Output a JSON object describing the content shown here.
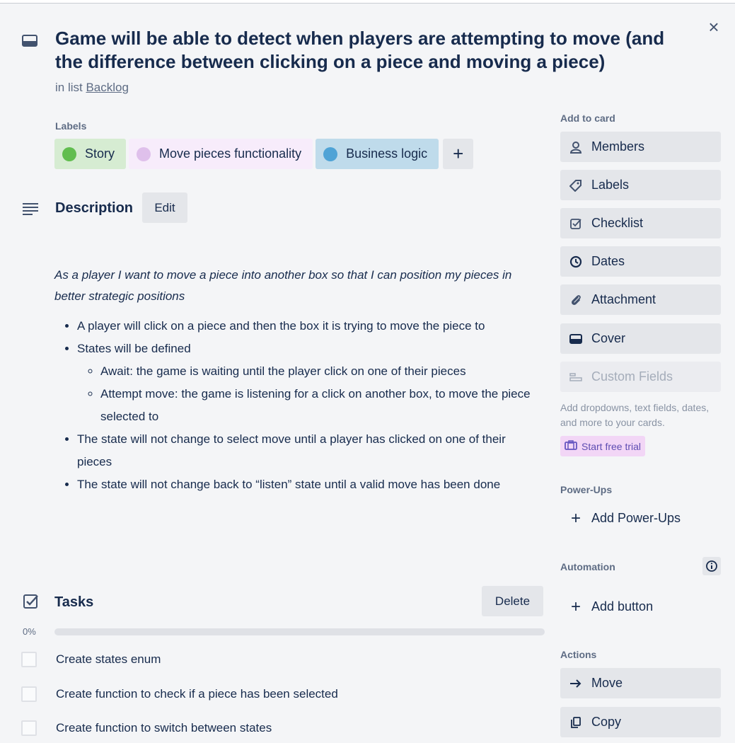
{
  "card": {
    "title": "Game will be able to detect when players are attempting to move (and the difference between clicking on a piece and moving a piece)",
    "in_list_prefix": "in list",
    "list_name": "Backlog",
    "close_label": "×"
  },
  "labels": {
    "heading": "Labels",
    "items": [
      {
        "name": "Story",
        "color": "#61bd4f",
        "bg": "#d6ecd2"
      },
      {
        "name": "Move pieces functionality",
        "color": "#dfc0eb",
        "bg": "#f7ecfb"
      },
      {
        "name": "Business logic",
        "color": "#4fa3d6",
        "bg": "#bfdbeb"
      }
    ],
    "add_label": "+"
  },
  "description": {
    "heading": "Description",
    "edit_label": "Edit",
    "story": "As a player I want to move a piece into another box so that I can position my pieces in better strategic positions",
    "bullets": [
      "A player will click on a piece and then the box it is trying to move the piece to",
      "States will be defined",
      "The state will not change to select move until a player has clicked on one of their pieces",
      "The state will not change back to “listen” state until a valid move has been done"
    ],
    "sub_bullets": [
      "Await: the game is waiting until the player click on one of their pieces",
      "Attempt move: the game is listening for a click on another box, to move the piece selected to"
    ]
  },
  "checklist": {
    "heading": "Tasks",
    "delete_label": "Delete",
    "progress_text": "0%",
    "progress_value": 0,
    "items": [
      {
        "text": "Create states enum",
        "checked": false
      },
      {
        "text": "Create function to check if a piece has been selected",
        "checked": false
      },
      {
        "text": "Create function to switch between states",
        "checked": false
      }
    ]
  },
  "sidebar": {
    "add_to_card_heading": "Add to card",
    "add_to_card": [
      {
        "label": "Members",
        "icon": "person-icon"
      },
      {
        "label": "Labels",
        "icon": "tag-icon"
      },
      {
        "label": "Checklist",
        "icon": "checkbox-icon"
      },
      {
        "label": "Dates",
        "icon": "clock-icon"
      },
      {
        "label": "Attachment",
        "icon": "paperclip-icon"
      },
      {
        "label": "Cover",
        "icon": "cover-icon"
      },
      {
        "label": "Custom Fields",
        "icon": "custom-fields-icon"
      }
    ],
    "custom_fields_note": "Add dropdowns, text fields, dates, and more to your cards.",
    "trial_label": "Start free trial",
    "powerups_heading": "Power-Ups",
    "add_powerups_label": "Add Power-Ups",
    "automation_heading": "Automation",
    "add_button_label": "Add button",
    "actions_heading": "Actions",
    "actions": [
      {
        "label": "Move",
        "icon": "arrow-right-icon"
      },
      {
        "label": "Copy",
        "icon": "copy-icon"
      }
    ]
  }
}
